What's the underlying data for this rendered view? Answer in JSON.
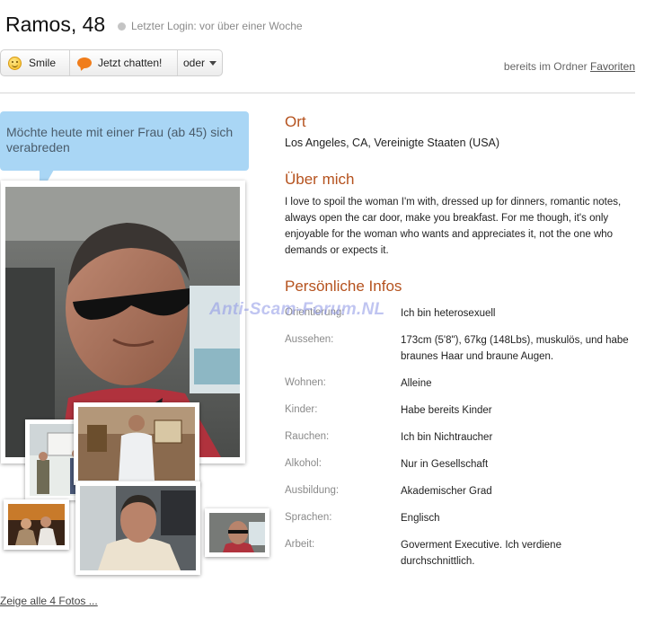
{
  "header": {
    "name": "Ramos, 48",
    "last_login": "Letzter Login: vor über einer Woche"
  },
  "actions": {
    "smile_label": "Smile",
    "chat_label": "Jetzt chatten!",
    "more_label": "oder"
  },
  "folder": {
    "prefix": "bereits im Ordner",
    "link": "Favoriten"
  },
  "bubble_text": "Möchte heute mit einer Frau (ab 45) sich verabreden",
  "photos": {
    "show_all": "Zeige alle 4 Fotos ..."
  },
  "location": {
    "title": "Ort",
    "value": "Los Angeles, CA, Vereinigte Staaten (USA)"
  },
  "about": {
    "title": "Über mich",
    "text": "I love to spoil the woman I'm with, dressed up for dinners, romantic notes, always open the car door, make you breakfast. For me though, it's only enjoyable for the woman who wants and appreciates it, not the one who demands or expects it."
  },
  "infos": {
    "title": "Persönliche Infos",
    "rows": [
      {
        "label": "Orientierung:",
        "value": "Ich bin heterosexuell"
      },
      {
        "label": "Aussehen:",
        "value": "173cm (5'8\"), 67kg (148Lbs), muskulös, und habe braunes Haar und braune Augen."
      },
      {
        "label": "Wohnen:",
        "value": "Alleine"
      },
      {
        "label": "Kinder:",
        "value": "Habe bereits Kinder"
      },
      {
        "label": "Rauchen:",
        "value": "Ich bin Nichtraucher"
      },
      {
        "label": "Alkohol:",
        "value": "Nur in Gesellschaft"
      },
      {
        "label": "Ausbildung:",
        "value": "Akademischer Grad"
      },
      {
        "label": "Sprachen:",
        "value": "Englisch"
      },
      {
        "label": "Arbeit:",
        "value": "Goverment Executive. Ich verdiene durchschnittlich."
      }
    ]
  },
  "watermark": "Anti-Scam-Forum.NL",
  "colors": {
    "section_title": "#b5521e",
    "bubble_bg": "#a9d6f5",
    "label_gray": "#8a8a8a"
  }
}
